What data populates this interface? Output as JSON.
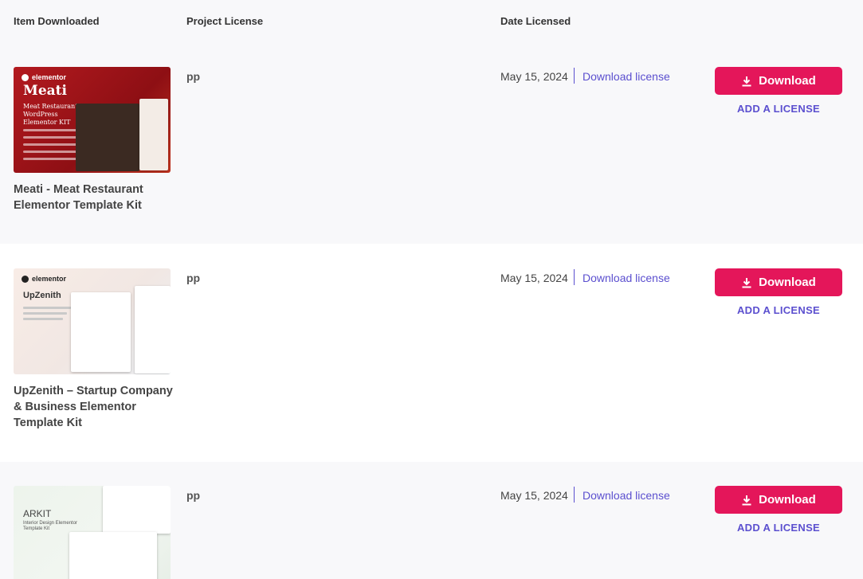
{
  "header": {
    "col_item": "Item Downloaded",
    "col_license": "Project License",
    "col_date": "Date Licensed"
  },
  "rows": [
    {
      "thumb_brand": "elementor",
      "thumb_kit_name": "Meati",
      "thumb_kit_sub": "Meat Restaurant WordPress Elementor KIT",
      "title": "Meati - Meat Restaurant Elementor Template Kit",
      "license": "pp",
      "date": "May 15, 2024",
      "download_license": "Download license",
      "download_label": "Download",
      "add_license": "ADD A LICENSE"
    },
    {
      "thumb_brand": "elementor",
      "thumb_kit_name": "UpZenith",
      "title": "UpZenith – Startup Company & Business Elementor Template Kit",
      "license": "pp",
      "date": "May 15, 2024",
      "download_license": "Download license",
      "download_label": "Download",
      "add_license": "ADD A LICENSE"
    },
    {
      "thumb_kit_name": "ARKIT",
      "thumb_kit_sub": "Interior Design Elementor Template Kit",
      "title": "",
      "license": "pp",
      "date": "May 15, 2024",
      "download_license": "Download license",
      "download_label": "Download",
      "add_license": "ADD A LICENSE"
    }
  ],
  "colors": {
    "accent": "#e4165a",
    "link": "#5b4fcf",
    "row_alt_bg": "#f8f8fa"
  }
}
